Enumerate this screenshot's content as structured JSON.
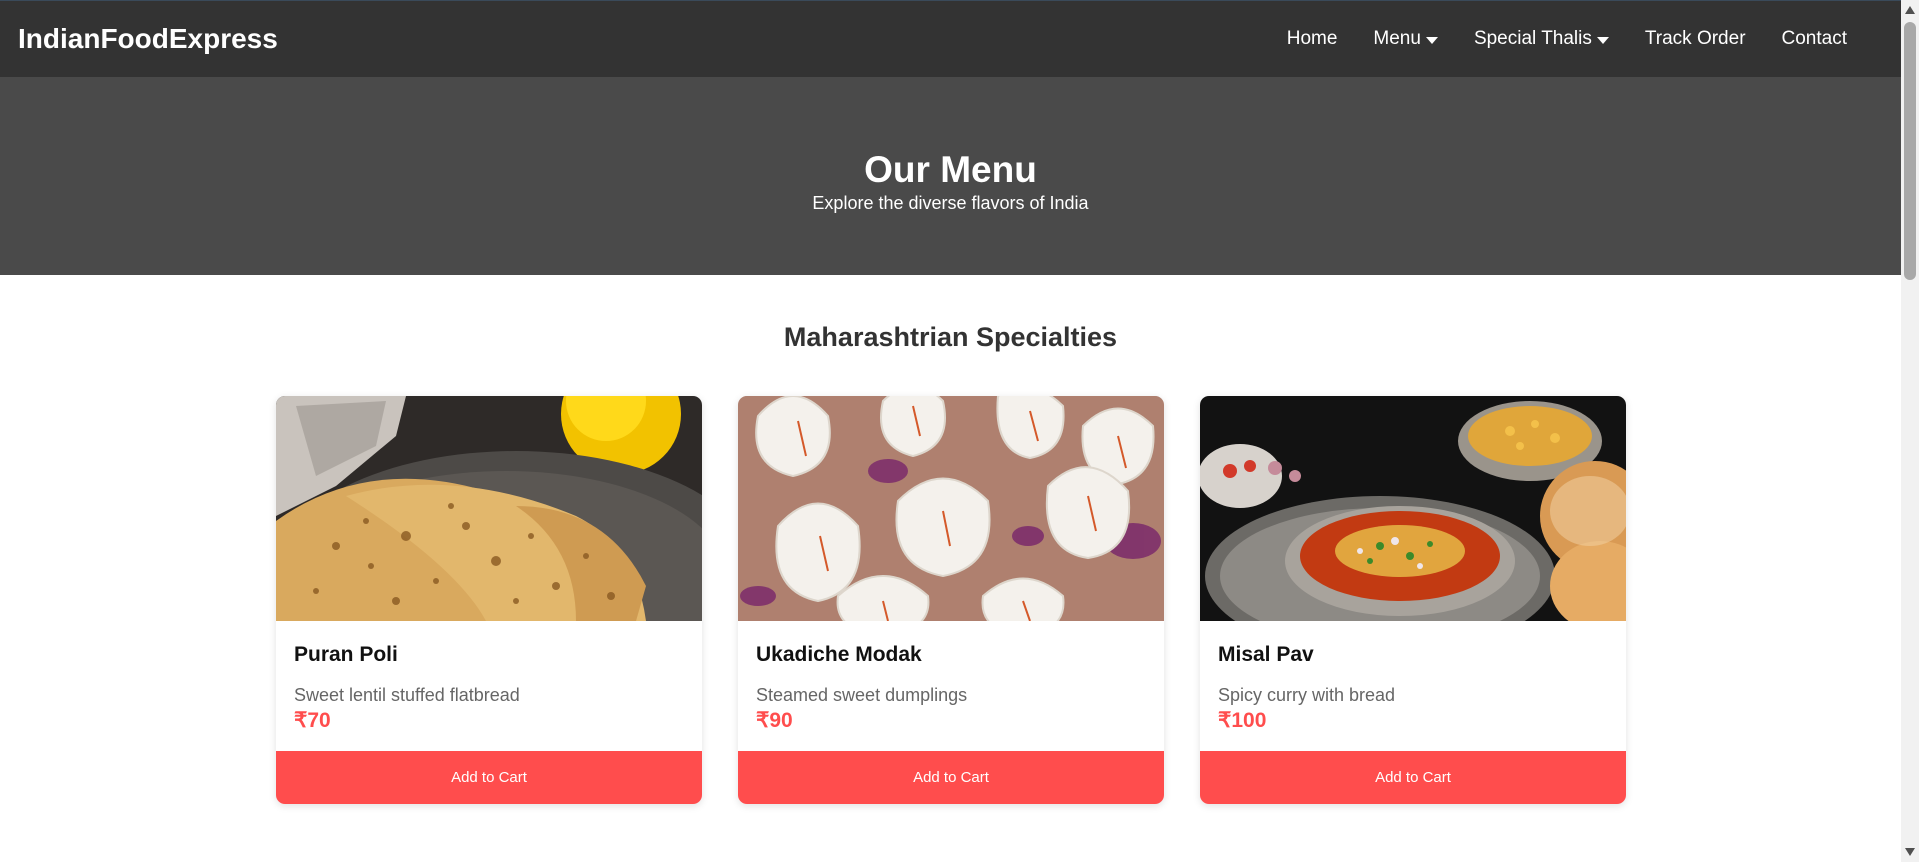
{
  "navbar": {
    "brand": "IndianFoodExpress",
    "items": [
      {
        "label": "Home",
        "dropdown": false
      },
      {
        "label": "Menu",
        "dropdown": true
      },
      {
        "label": "Special Thalis",
        "dropdown": true
      },
      {
        "label": "Track Order",
        "dropdown": false
      },
      {
        "label": "Contact",
        "dropdown": false
      }
    ]
  },
  "hero": {
    "title": "Our Menu",
    "subtitle": "Explore the diverse flavors of India"
  },
  "section": {
    "title": "Maharashtrian Specialties"
  },
  "cards": [
    {
      "name": "Puran Poli",
      "description": "Sweet lentil stuffed flatbread",
      "price": "₹70",
      "button": "Add to Cart",
      "image": "puran-poli-photo"
    },
    {
      "name": "Ukadiche Modak",
      "description": "Steamed sweet dumplings",
      "price": "₹90",
      "button": "Add to Cart",
      "image": "modak-photo"
    },
    {
      "name": "Misal Pav",
      "description": "Spicy curry with bread",
      "price": "₹100",
      "button": "Add to Cart",
      "image": "misal-pav-photo"
    }
  ],
  "colors": {
    "navbar_bg": "#333333",
    "hero_bg": "#4a4a4a",
    "accent": "#ff4d4d"
  }
}
